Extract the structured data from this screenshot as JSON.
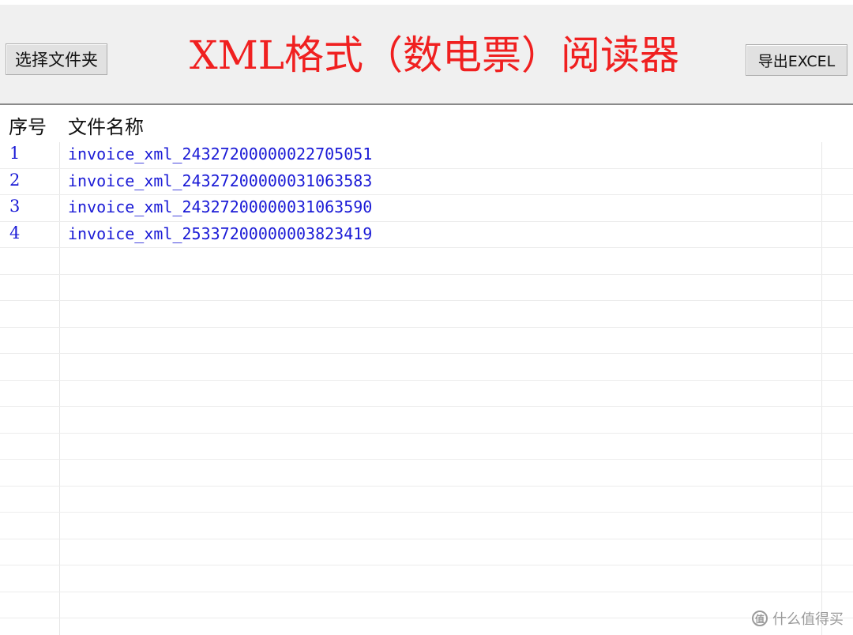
{
  "toolbar": {
    "select_folder_label": "选择文件夹",
    "title": "XML格式（数电票）阅读器",
    "export_label": "导出EXCEL"
  },
  "table": {
    "columns": [
      "序号",
      "文件名称"
    ],
    "rows": [
      {
        "index": "1",
        "name": "invoice_xml_24327200000022705051"
      },
      {
        "index": "2",
        "name": "invoice_xml_24327200000031063583"
      },
      {
        "index": "3",
        "name": "invoice_xml_24327200000031063590"
      },
      {
        "index": "4",
        "name": "invoice_xml_25337200000003823419"
      }
    ]
  },
  "watermark": {
    "logo_glyph": "值",
    "text": "什么值得买"
  },
  "colors": {
    "title": "#f02020",
    "row_text": "#1a1ad6",
    "toolbar_bg": "#f0f0f0"
  }
}
